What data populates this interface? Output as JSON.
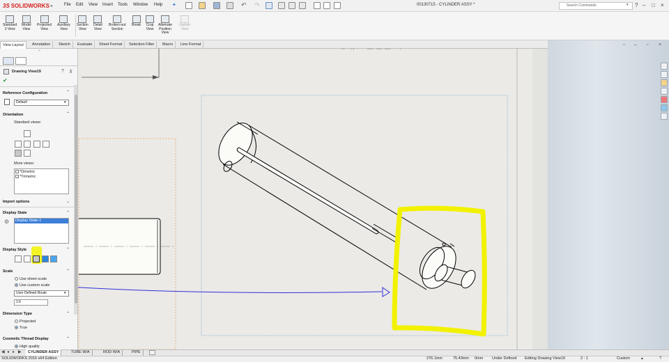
{
  "app": {
    "logo_prefix": "3S",
    "logo_name": "SOLIDWORKS",
    "document_title": "00130715 - CYLINDER ASSY *",
    "search_placeholder": "Search Commands",
    "menu": [
      "File",
      "Edit",
      "View",
      "Insert",
      "Tools",
      "Window",
      "Help"
    ]
  },
  "commands": [
    {
      "label1": "Standard",
      "label2": "3 View",
      "label3": "",
      "disabled": false
    },
    {
      "label1": "Model",
      "label2": "View",
      "label3": "",
      "disabled": false
    },
    {
      "label1": "Projected",
      "label2": "View",
      "label3": "",
      "disabled": false
    },
    {
      "label1": "Auxiliary",
      "label2": "View",
      "label3": "",
      "disabled": false
    },
    {
      "label1": "Section",
      "label2": "View",
      "label3": "",
      "disabled": false
    },
    {
      "label1": "Detail",
      "label2": "View",
      "label3": "",
      "disabled": false
    },
    {
      "label1": "Broken-out",
      "label2": "Section",
      "label3": "",
      "disabled": false
    },
    {
      "label1": "Break",
      "label2": "",
      "label3": "",
      "disabled": false
    },
    {
      "label1": "Crop",
      "label2": "View",
      "label3": "",
      "disabled": false
    },
    {
      "label1": "Alternate",
      "label2": "Position",
      "label3": "View",
      "disabled": false
    },
    {
      "label1": "Update",
      "label2": "View",
      "label3": "",
      "disabled": true
    }
  ],
  "tabs": [
    "View Layout",
    "Annotation",
    "Sketch",
    "Evaluate",
    "Sheet Format",
    "Selection Filter",
    "Macro",
    "Line Format"
  ],
  "property_manager": {
    "title": "Drawing View19",
    "reference_configuration": {
      "heading": "Reference Configuration",
      "value": "Default"
    },
    "orientation": {
      "heading": "Orientation",
      "standard_views": "Standard views:",
      "more_views": "More views:",
      "more_views_items": [
        "*Dimetric",
        "*Trimetric"
      ]
    },
    "import_options": {
      "heading": "Import options"
    },
    "display_state": {
      "heading": "Display State",
      "item": "Display State-1"
    },
    "display_style": {
      "heading": "Display Style"
    },
    "scale": {
      "heading": "Scale",
      "use_sheet": "Use sheet scale",
      "use_custom": "Use custom scale",
      "custom_selected": true,
      "preset": "User Defined Route",
      "value": "1:6"
    },
    "dimension_type": {
      "heading": "Dimension Type",
      "projected": "Projected",
      "true_label": "True",
      "true_selected": true
    },
    "cosmetic_thread": {
      "heading": "Cosmetic Thread Display",
      "high_quality": "High quality"
    }
  },
  "sheet_tabs": [
    "CYLINDER ASSY",
    "TUBE W/A",
    "ROD W/A",
    "PIPE"
  ],
  "status_bar": {
    "edition": "SOLIDWORKS 2016 x64 Edition",
    "x": "276.1mm",
    "y": "75.43mm",
    "z": "0mm",
    "state": "Under Defined",
    "editing": "Editing Drawing View19",
    "scale": "2 : 1",
    "units": "Custom"
  },
  "colors": {
    "brand": "#d41f1f",
    "highlight": "#f2f200",
    "annotation_arrow": "#2f2fd9",
    "view_border": "#7fa9d8"
  }
}
